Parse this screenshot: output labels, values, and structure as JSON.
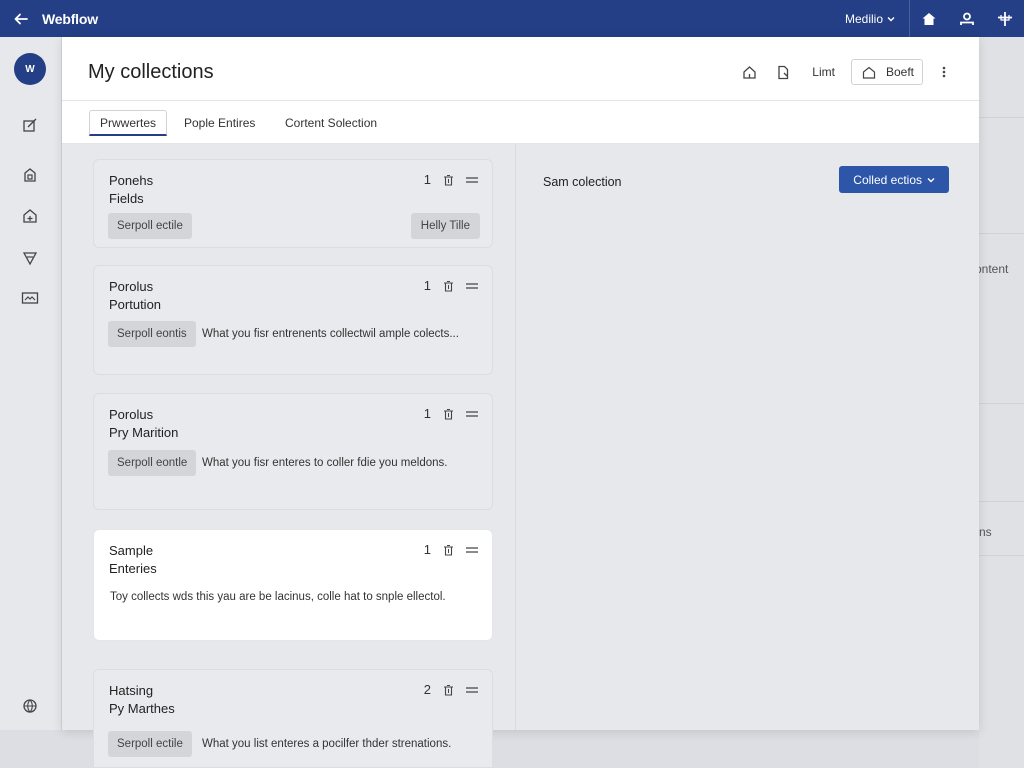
{
  "topbar": {
    "brand": "Webflow",
    "menu_label": "Medilio",
    "icons": [
      "back-arrow-icon",
      "home-icon",
      "user-icon",
      "plus-icon"
    ]
  },
  "rail": {
    "avatar_initials": "W",
    "items": [
      "edit-icon",
      "page-icon",
      "building-icon",
      "filter-icon",
      "image-icon",
      "globe-icon"
    ]
  },
  "background": {
    "text_1": "ontent",
    "text_2": "ns"
  },
  "modal": {
    "title": "My collections",
    "header_actions": {
      "link_label": "Limt",
      "boot_label": "Boeft"
    },
    "tabs": [
      {
        "label": "Prwwertes",
        "active": true
      },
      {
        "label": "Pople Entires",
        "active": false
      },
      {
        "label": "Cortent Solection",
        "active": false
      }
    ],
    "cards": [
      {
        "name_line1": "Ponehs",
        "name_line2": "Fields",
        "count": "1",
        "chip": "Serpoll ectile",
        "chip_right": "Helly Tille",
        "desc": ""
      },
      {
        "name_line1": "Porolus",
        "name_line2": "Portution",
        "count": "1",
        "chip": "Serpoll eontis",
        "chip_right": "",
        "desc": "What you fisr entrenents collectwil ample colects..."
      },
      {
        "name_line1": "Porolus",
        "name_line2": "Pry Marition",
        "count": "1",
        "chip": "Serpoll eontle",
        "chip_right": "",
        "desc": "What you fisr enteres to coller fdie you meldons."
      },
      {
        "name_line1": "Sample",
        "name_line2": "Enteries",
        "count": "1",
        "chip": "",
        "chip_right": "",
        "desc": "Toy collects wds this yau are be lacinus, colle hat to snple ellectol."
      },
      {
        "name_line1": "Hatsing",
        "name_line2": "Py Marthes",
        "count": "2",
        "chip": "Serpoll ectile",
        "chip_right": "",
        "desc": "What you list enteres a pocilfer thder strenations."
      }
    ],
    "detail": {
      "label": "Sam colection",
      "primary_button": "Colled ectios"
    }
  },
  "colors": {
    "topbar": "#243f86",
    "primary": "#2d56a8"
  }
}
